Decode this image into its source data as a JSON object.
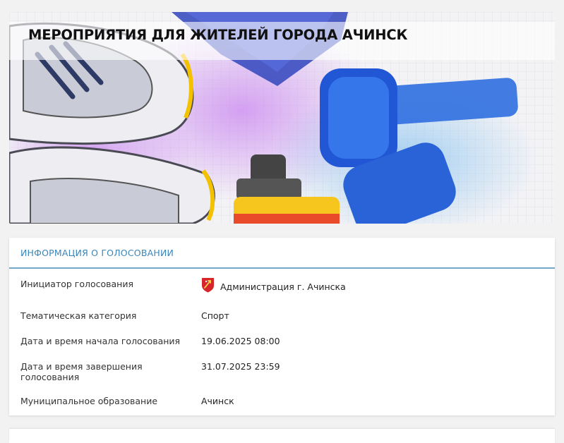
{
  "banner": {
    "title": "МЕРОПРИЯТИЯ ДЛЯ ЖИТЕЛЕЙ ГОРОДА АЧИНСК",
    "image_icon": "sport-equipment-illustration"
  },
  "info": {
    "header": "ИНФОРМАЦИЯ О ГОЛОСОВАНИИ",
    "rows": [
      {
        "label": "Инициатор голосования",
        "value": "Администрация г. Ачинска",
        "icon": "coat-of-arms-icon"
      },
      {
        "label": "Тематическая категория",
        "value": "Спорт"
      },
      {
        "label": "Дата и время начала голосования",
        "value": "19.06.2025 08:00"
      },
      {
        "label": "Дата и время завершения голосования",
        "value": "31.07.2025 23:59"
      },
      {
        "label": "Муниципальное образование",
        "value": "Ачинск"
      }
    ]
  },
  "colors": {
    "accent": "#3a86b9",
    "header_border": "#6fa8c8",
    "icon_red": "#d7262b"
  }
}
